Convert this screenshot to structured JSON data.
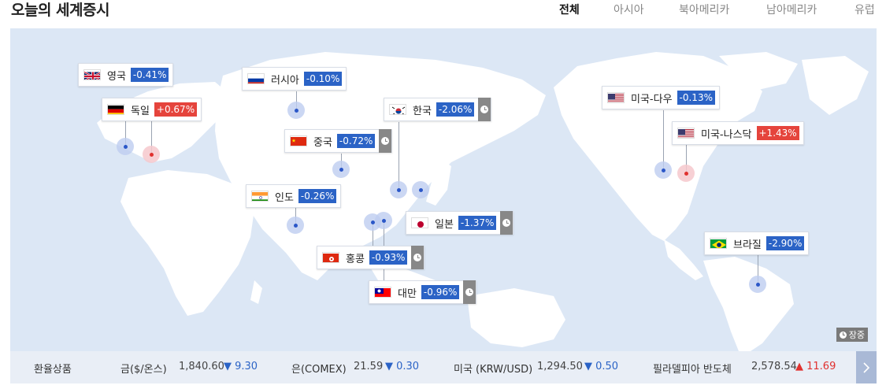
{
  "header": {
    "title": "오늘의 세계증시",
    "tabs": [
      {
        "label": "전체",
        "active": true
      },
      {
        "label": "아시아",
        "active": false
      },
      {
        "label": "북아메리카",
        "active": false
      },
      {
        "label": "남아메리카",
        "active": false
      },
      {
        "label": "유럽",
        "active": false
      }
    ]
  },
  "markets": [
    {
      "name": "영국",
      "change": "-0.41%",
      "dir": "down",
      "clock": false
    },
    {
      "name": "독일",
      "change": "+0.67%",
      "dir": "up",
      "clock": false
    },
    {
      "name": "러시아",
      "change": "-0.10%",
      "dir": "down",
      "clock": false
    },
    {
      "name": "한국",
      "change": "-2.06%",
      "dir": "down",
      "clock": true
    },
    {
      "name": "중국",
      "change": "-0.72%",
      "dir": "down",
      "clock": true
    },
    {
      "name": "인도",
      "change": "-0.26%",
      "dir": "down",
      "clock": false
    },
    {
      "name": "일본",
      "change": "-1.37%",
      "dir": "down",
      "clock": true
    },
    {
      "name": "홍콩",
      "change": "-0.93%",
      "dir": "down",
      "clock": true
    },
    {
      "name": "대만",
      "change": "-0.96%",
      "dir": "down",
      "clock": true
    },
    {
      "name": "미국-다우",
      "change": "-0.13%",
      "dir": "down",
      "clock": false
    },
    {
      "name": "미국-나스닥",
      "change": "+1.43%",
      "dir": "up",
      "clock": false
    },
    {
      "name": "브라질",
      "change": "-2.90%",
      "dir": "down",
      "clock": false
    }
  ],
  "closed_label": "장중",
  "ticker": {
    "title": "환율상품",
    "items": [
      {
        "label": "금($/온스)",
        "value": "1,840.60",
        "change": "▼ 9.30",
        "dir": "down"
      },
      {
        "label": "은(COMEX)",
        "value": "21.59",
        "change": "▼ 0.30",
        "dir": "down"
      },
      {
        "label": "미국 (KRW/USD)",
        "value": "1,294.50",
        "change": "▼ 0.50",
        "dir": "down"
      },
      {
        "label": "필라델피아 반도체",
        "value": "2,578.54",
        "change": "▲ 11.69",
        "dir": "up"
      }
    ],
    "next_icon": "chevron-right-icon"
  },
  "colors": {
    "map_bg": "#dce7f5",
    "land": "#ffffff",
    "down": "#2b63c6",
    "up": "#e5443c",
    "clock_bg": "#888888"
  }
}
